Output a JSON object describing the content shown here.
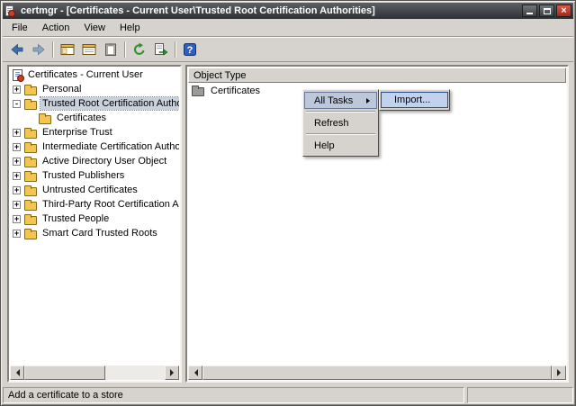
{
  "window": {
    "title": "certmgr - [Certificates - Current User\\Trusted Root Certification Authorities]",
    "controls": [
      "minimize",
      "maximize",
      "close"
    ]
  },
  "menubar": {
    "file": "File",
    "action": "Action",
    "view": "View",
    "help": "Help"
  },
  "toolbar": {
    "icons": [
      "back-icon",
      "forward-icon",
      "show-hide-console-tree-icon",
      "properties-icon",
      "paste-icon",
      "refresh-icon",
      "export-list-icon",
      "help-icon"
    ]
  },
  "tree": {
    "items": [
      {
        "label": "Certificates - Current User",
        "expand": "",
        "icon": "certmgr-root-icon",
        "selected": false
      },
      {
        "label": "Personal",
        "expand": "+",
        "icon": "folder-icon",
        "selected": false
      },
      {
        "label": "Trusted Root Certification Autho",
        "expand": "-",
        "icon": "folder-icon",
        "selected": true
      },
      {
        "label": "Certificates",
        "expand": "",
        "icon": "folder-icon",
        "selected": false
      },
      {
        "label": "Enterprise Trust",
        "expand": "+",
        "icon": "folder-icon",
        "selected": false
      },
      {
        "label": "Intermediate Certification Autho",
        "expand": "+",
        "icon": "folder-icon",
        "selected": false
      },
      {
        "label": "Active Directory User Object",
        "expand": "+",
        "icon": "folder-icon",
        "selected": false
      },
      {
        "label": "Trusted Publishers",
        "expand": "+",
        "icon": "folder-icon",
        "selected": false
      },
      {
        "label": "Untrusted Certificates",
        "expand": "+",
        "icon": "folder-icon",
        "selected": false
      },
      {
        "label": "Third-Party Root Certification Au",
        "expand": "+",
        "icon": "folder-icon",
        "selected": false
      },
      {
        "label": "Trusted People",
        "expand": "+",
        "icon": "folder-icon",
        "selected": false
      },
      {
        "label": "Smart Card Trusted Roots",
        "expand": "+",
        "icon": "folder-icon",
        "selected": false
      }
    ]
  },
  "list": {
    "header": "Object Type",
    "items": [
      {
        "label": "Certificates",
        "icon": "certificates-folder-icon"
      }
    ]
  },
  "context_menu": {
    "items": [
      {
        "label": "All Tasks",
        "has_submenu": true,
        "highlighted": true
      },
      {
        "label": "Refresh",
        "has_submenu": false,
        "highlighted": false
      },
      {
        "label": "Help",
        "has_submenu": false,
        "highlighted": false
      }
    ],
    "submenu": {
      "items": [
        {
          "label": "Import...",
          "highlighted": true
        }
      ]
    }
  },
  "statusbar": {
    "text": "Add a certificate to a store"
  }
}
